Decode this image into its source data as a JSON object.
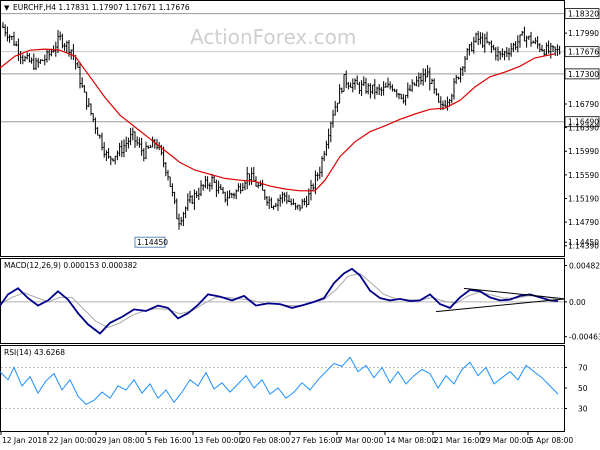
{
  "chart_data": [
    {
      "type": "ohlc",
      "panel": "price",
      "title": "EURCHF,H4  1.17831 1.17907 1.17671 1.17676",
      "watermark": "ActionForex.com",
      "y_ticks": [
        "1.18320",
        "1.17990",
        "1.17676",
        "1.17300",
        "1.16790",
        "1.16490",
        "1.16390",
        "1.15990",
        "1.15590",
        "1.15190",
        "1.14790",
        "1.14450",
        "1.14390"
      ],
      "horizontal_levels": [
        {
          "value": 1.1832,
          "label": "1.18320",
          "color": "#9a9a9a"
        },
        {
          "value": 1.173,
          "label": "1.17300",
          "color": "#9a9a9a"
        },
        {
          "value": 1.1649,
          "label": "1.16490",
          "color": "#9a9a9a"
        }
      ],
      "current_price": {
        "value": 1.17676,
        "label": "1.17676"
      },
      "annotation_low": {
        "value": 1.1445,
        "label": "1.14450"
      },
      "ylim": [
        1.1425,
        1.185
      ],
      "close_path": [
        [
          0,
          1.1815
        ],
        [
          12,
          1.179
        ],
        [
          24,
          1.1755
        ],
        [
          36,
          1.1745
        ],
        [
          48,
          1.176
        ],
        [
          60,
          1.179
        ],
        [
          72,
          1.177
        ],
        [
          84,
          1.1695
        ],
        [
          96,
          1.164
        ],
        [
          108,
          1.1585
        ],
        [
          120,
          1.16
        ],
        [
          132,
          1.1625
        ],
        [
          144,
          1.1595
        ],
        [
          156,
          1.1615
        ],
        [
          168,
          1.156
        ],
        [
          178,
          1.148
        ],
        [
          188,
          1.151
        ],
        [
          200,
          1.1535
        ],
        [
          212,
          1.155
        ],
        [
          224,
          1.152
        ],
        [
          236,
          1.153
        ],
        [
          248,
          1.156
        ],
        [
          260,
          1.1535
        ],
        [
          272,
          1.151
        ],
        [
          284,
          1.1525
        ],
        [
          296,
          1.15
        ],
        [
          308,
          1.152
        ],
        [
          320,
          1.157
        ],
        [
          332,
          1.166
        ],
        [
          344,
          1.172
        ],
        [
          356,
          1.171
        ],
        [
          368,
          1.1705
        ],
        [
          380,
          1.17
        ],
        [
          392,
          1.171
        ],
        [
          404,
          1.169
        ],
        [
          416,
          1.1715
        ],
        [
          428,
          1.173
        ],
        [
          440,
          1.167
        ],
        [
          452,
          1.17
        ],
        [
          464,
          1.1755
        ],
        [
          476,
          1.179
        ],
        [
          488,
          1.178
        ],
        [
          500,
          1.176
        ],
        [
          512,
          1.1775
        ],
        [
          524,
          1.1795
        ],
        [
          536,
          1.178
        ],
        [
          548,
          1.1768
        ]
      ],
      "ma_path": [
        [
          0,
          1.174
        ],
        [
          15,
          1.176
        ],
        [
          30,
          1.177
        ],
        [
          45,
          1.1772
        ],
        [
          60,
          1.177
        ],
        [
          75,
          1.176
        ],
        [
          90,
          1.1725
        ],
        [
          105,
          1.169
        ],
        [
          120,
          1.166
        ],
        [
          135,
          1.164
        ],
        [
          150,
          1.162
        ],
        [
          165,
          1.16
        ],
        [
          180,
          1.158
        ],
        [
          195,
          1.1567
        ],
        [
          210,
          1.156
        ],
        [
          225,
          1.1553
        ],
        [
          240,
          1.155
        ],
        [
          255,
          1.1548
        ],
        [
          270,
          1.154
        ],
        [
          285,
          1.1535
        ],
        [
          300,
          1.1532
        ],
        [
          315,
          1.1532
        ],
        [
          325,
          1.155
        ],
        [
          340,
          1.159
        ],
        [
          355,
          1.1615
        ],
        [
          370,
          1.1632
        ],
        [
          385,
          1.1642
        ],
        [
          400,
          1.1653
        ],
        [
          415,
          1.1662
        ],
        [
          430,
          1.167
        ],
        [
          445,
          1.1672
        ],
        [
          460,
          1.1685
        ],
        [
          475,
          1.1708
        ],
        [
          490,
          1.1725
        ],
        [
          505,
          1.1733
        ],
        [
          520,
          1.1743
        ],
        [
          535,
          1.1757
        ],
        [
          555,
          1.1764
        ]
      ]
    },
    {
      "type": "line",
      "panel": "macd",
      "title": "MACD(12,26,9) 0.000153 0.000382",
      "y_ticks": [
        "0.004827",
        "0.00",
        "-0.004632"
      ],
      "ylim": [
        -0.0052,
        0.0053
      ],
      "macd_path": [
        [
          0,
          -0.0005
        ],
        [
          8,
          0.001
        ],
        [
          18,
          0.0018
        ],
        [
          28,
          0.0005
        ],
        [
          38,
          -0.0005
        ],
        [
          48,
          0.0002
        ],
        [
          58,
          0.0014
        ],
        [
          68,
          0.0003
        ],
        [
          78,
          -0.0015
        ],
        [
          88,
          -0.003
        ],
        [
          100,
          -0.0042
        ],
        [
          110,
          -0.0028
        ],
        [
          122,
          -0.002
        ],
        [
          134,
          -0.001
        ],
        [
          146,
          -0.0012
        ],
        [
          158,
          -0.0005
        ],
        [
          168,
          -0.0008
        ],
        [
          178,
          -0.0022
        ],
        [
          188,
          -0.0015
        ],
        [
          198,
          -0.0004
        ],
        [
          208,
          0.001
        ],
        [
          220,
          0.0007
        ],
        [
          232,
          0.0002
        ],
        [
          244,
          0.0008
        ],
        [
          256,
          -0.0005
        ],
        [
          268,
          -0.0002
        ],
        [
          280,
          -0.0003
        ],
        [
          292,
          -0.0008
        ],
        [
          304,
          -0.0004
        ],
        [
          314,
          0.0
        ],
        [
          324,
          0.0005
        ],
        [
          334,
          0.0025
        ],
        [
          344,
          0.0038
        ],
        [
          352,
          0.0044
        ],
        [
          360,
          0.0035
        ],
        [
          370,
          0.0015
        ],
        [
          380,
          0.0005
        ],
        [
          390,
          0.0002
        ],
        [
          400,
          0.0004
        ],
        [
          410,
          0.0001
        ],
        [
          420,
          0.0002
        ],
        [
          430,
          0.001
        ],
        [
          440,
          -0.0003
        ],
        [
          450,
          -0.0008
        ],
        [
          460,
          0.0006
        ],
        [
          470,
          0.0016
        ],
        [
          480,
          0.0014
        ],
        [
          490,
          0.0006
        ],
        [
          500,
          0.0002
        ],
        [
          510,
          0.0003
        ],
        [
          520,
          0.0008
        ],
        [
          530,
          0.001
        ],
        [
          540,
          0.0006
        ],
        [
          550,
          0.0002
        ],
        [
          558,
          0.0001
        ]
      ],
      "signal_path": [
        [
          0,
          -0.0003
        ],
        [
          12,
          0.0006
        ],
        [
          24,
          0.0012
        ],
        [
          36,
          0.0006
        ],
        [
          48,
          0.0
        ],
        [
          60,
          0.0006
        ],
        [
          72,
          0.0006
        ],
        [
          84,
          -0.001
        ],
        [
          96,
          -0.0026
        ],
        [
          108,
          -0.0034
        ],
        [
          120,
          -0.0028
        ],
        [
          132,
          -0.0018
        ],
        [
          144,
          -0.0012
        ],
        [
          156,
          -0.0009
        ],
        [
          168,
          -0.001
        ],
        [
          180,
          -0.0016
        ],
        [
          192,
          -0.0012
        ],
        [
          204,
          -0.0002
        ],
        [
          216,
          0.0006
        ],
        [
          228,
          0.0006
        ],
        [
          240,
          0.0004
        ],
        [
          252,
          0.0002
        ],
        [
          264,
          -0.0002
        ],
        [
          276,
          -0.0003
        ],
        [
          288,
          -0.0005
        ],
        [
          300,
          -0.0005
        ],
        [
          312,
          -0.0001
        ],
        [
          324,
          0.0003
        ],
        [
          336,
          0.0016
        ],
        [
          348,
          0.0034
        ],
        [
          360,
          0.0038
        ],
        [
          372,
          0.0024
        ],
        [
          384,
          0.001
        ],
        [
          396,
          0.0004
        ],
        [
          408,
          0.0003
        ],
        [
          420,
          0.0002
        ],
        [
          432,
          0.0006
        ],
        [
          444,
          0.0001
        ],
        [
          456,
          -0.0002
        ],
        [
          468,
          0.0008
        ],
        [
          480,
          0.0013
        ],
        [
          492,
          0.0009
        ],
        [
          504,
          0.0005
        ],
        [
          516,
          0.0005
        ],
        [
          528,
          0.0008
        ],
        [
          540,
          0.0008
        ],
        [
          556,
          0.0004
        ]
      ],
      "trendlines": [
        {
          "from": [
            436,
            -0.0013
          ],
          "to": [
            565,
            0.0004
          ]
        },
        {
          "from": [
            464,
            0.0018
          ],
          "to": [
            565,
            0.0004
          ]
        }
      ]
    },
    {
      "type": "line",
      "panel": "rsi",
      "title": "RSI(14) 43.6268",
      "y_ticks": [
        "70",
        "50",
        "30"
      ],
      "ylim": [
        10,
        88
      ],
      "rsi_path": [
        [
          0,
          66
        ],
        [
          8,
          58
        ],
        [
          14,
          70
        ],
        [
          22,
          52
        ],
        [
          30,
          61
        ],
        [
          38,
          45
        ],
        [
          46,
          57
        ],
        [
          54,
          64
        ],
        [
          62,
          48
        ],
        [
          70,
          58
        ],
        [
          78,
          42
        ],
        [
          86,
          34
        ],
        [
          94,
          38
        ],
        [
          102,
          46
        ],
        [
          110,
          40
        ],
        [
          118,
          52
        ],
        [
          126,
          48
        ],
        [
          134,
          58
        ],
        [
          142,
          45
        ],
        [
          150,
          54
        ],
        [
          158,
          40
        ],
        [
          166,
          48
        ],
        [
          174,
          36
        ],
        [
          182,
          46
        ],
        [
          190,
          58
        ],
        [
          198,
          52
        ],
        [
          206,
          65
        ],
        [
          214,
          49
        ],
        [
          222,
          55
        ],
        [
          230,
          46
        ],
        [
          238,
          54
        ],
        [
          246,
          62
        ],
        [
          254,
          50
        ],
        [
          262,
          58
        ],
        [
          270,
          44
        ],
        [
          278,
          50
        ],
        [
          286,
          40
        ],
        [
          294,
          46
        ],
        [
          302,
          55
        ],
        [
          310,
          48
        ],
        [
          318,
          58
        ],
        [
          326,
          66
        ],
        [
          334,
          74
        ],
        [
          342,
          71
        ],
        [
          350,
          80
        ],
        [
          358,
          66
        ],
        [
          366,
          72
        ],
        [
          374,
          60
        ],
        [
          382,
          70
        ],
        [
          390,
          55
        ],
        [
          398,
          66
        ],
        [
          406,
          54
        ],
        [
          414,
          62
        ],
        [
          422,
          68
        ],
        [
          430,
          64
        ],
        [
          438,
          50
        ],
        [
          446,
          62
        ],
        [
          454,
          54
        ],
        [
          462,
          68
        ],
        [
          470,
          75
        ],
        [
          478,
          62
        ],
        [
          486,
          70
        ],
        [
          494,
          54
        ],
        [
          502,
          60
        ],
        [
          510,
          66
        ],
        [
          518,
          58
        ],
        [
          526,
          72
        ],
        [
          534,
          66
        ],
        [
          542,
          60
        ],
        [
          550,
          52
        ],
        [
          558,
          44
        ]
      ]
    }
  ],
  "x_axis": {
    "labels": [
      "12 Jan 2018",
      "22 Jan 00:00",
      "29 Jan 08:00",
      "5 Feb 16:00",
      "13 Feb 00:00",
      "20 Feb 08:00",
      "27 Feb 16:00",
      "7 Mar 00:00",
      "14 Mar 08:00",
      "21 Mar 16:00",
      "29 Mar 00:00",
      "5 Apr 08:00"
    ]
  },
  "colors": {
    "price_bars": "#000000",
    "ma": "#e00000",
    "macd_line": "#00008b",
    "signal_line": "#a9a9a9",
    "trendline": "#000000",
    "rsi_line": "#1e90ff",
    "levels": "#a0a0a0",
    "axis": "#000000"
  }
}
